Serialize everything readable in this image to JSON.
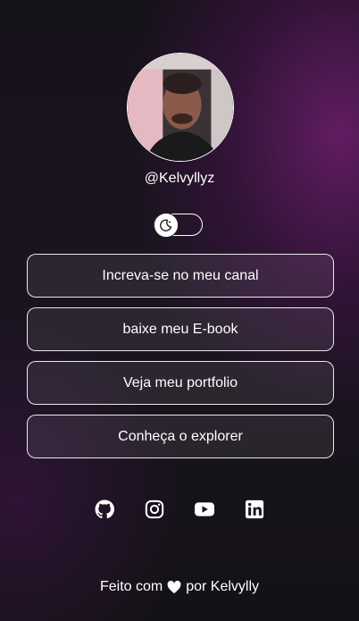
{
  "profile": {
    "username": "@Kelvyllyz",
    "avatar_icon": "profile-photo"
  },
  "theme_toggle": {
    "icon": "moon-icon",
    "state": "light"
  },
  "links": [
    {
      "label": "Increva-se no meu canal"
    },
    {
      "label": "baixe meu E-book"
    },
    {
      "label": "Veja meu portfolio"
    },
    {
      "label": "Conheça o explorer"
    }
  ],
  "socials": [
    {
      "icon": "github-icon"
    },
    {
      "icon": "instagram-icon"
    },
    {
      "icon": "youtube-icon"
    },
    {
      "icon": "linkedin-icon"
    }
  ],
  "footer": {
    "prefix": "Feito com",
    "heart_icon": "heart-icon",
    "suffix": "por Kelvylly"
  }
}
